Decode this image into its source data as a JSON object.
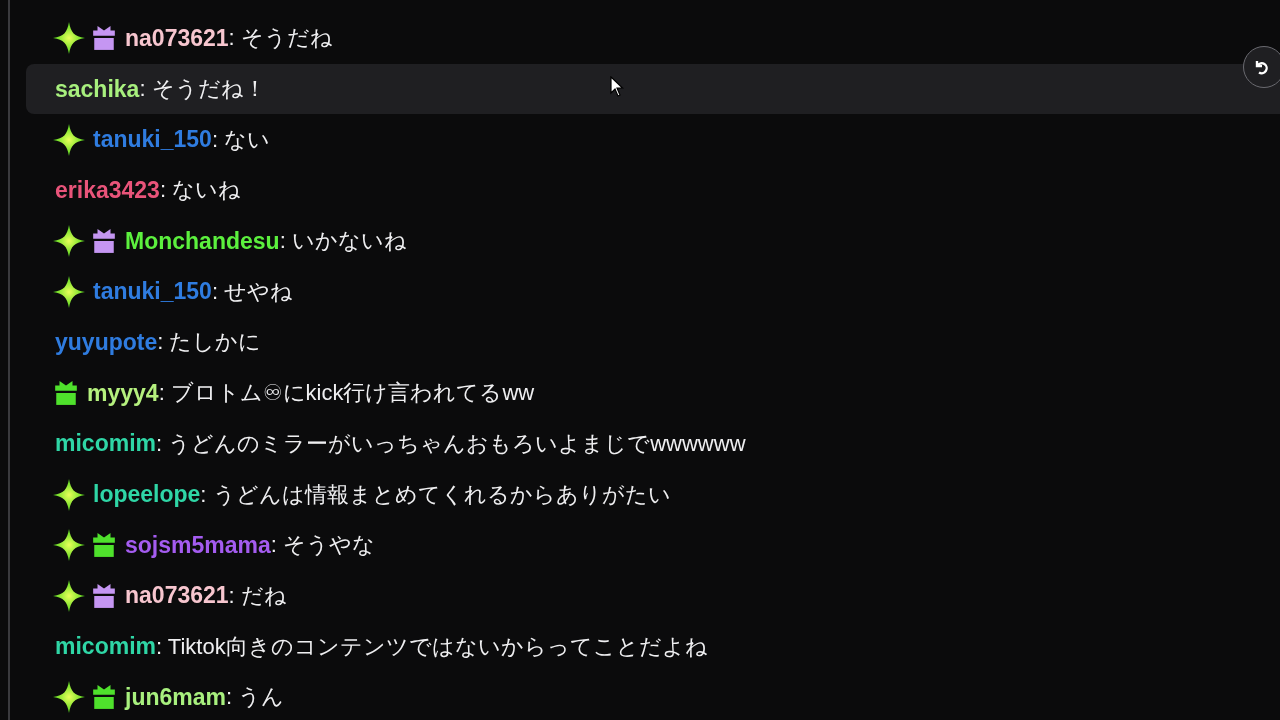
{
  "messages": [
    {
      "badges": [
        {
          "kind": "sparkle"
        },
        {
          "kind": "gift",
          "color": "#c596f2"
        }
      ],
      "username": "na073621",
      "color": "#f7c6cf",
      "text": ": そうだね",
      "highlighted": false
    },
    {
      "username": "sachika",
      "color": "#a8f07e",
      "text": ": そうだね！",
      "highlighted": true
    },
    {
      "badges": [
        {
          "kind": "sparkle"
        }
      ],
      "username": "tanuki_150",
      "color": "#2f7ce0",
      "text": ": ない",
      "highlighted": false
    },
    {
      "username": "erika3423",
      "color": "#e9547a",
      "text": ": ないね",
      "highlighted": false
    },
    {
      "badges": [
        {
          "kind": "sparkle"
        },
        {
          "kind": "gift",
          "color": "#c596f2"
        }
      ],
      "username": "Monchandesu",
      "color": "#5cf03e",
      "text": ": いかないね",
      "highlighted": false
    },
    {
      "badges": [
        {
          "kind": "sparkle"
        }
      ],
      "username": "tanuki_150",
      "color": "#2f7ce0",
      "text": ": せやね",
      "highlighted": false
    },
    {
      "username": "yuyupote",
      "color": "#2f7ce0",
      "text": ": たしかに",
      "highlighted": false
    },
    {
      "badges": [
        {
          "kind": "gift",
          "color": "#4fe12c"
        }
      ],
      "username": "myyy4",
      "color": "#b5f07e",
      "text": ": ブロトム♾にkick行け言われてるww",
      "highlighted": false
    },
    {
      "username": "micomim",
      "color": "#2fd6a6",
      "text": ": うどんのミラーがいっちゃんおもろいよまじでwwwwww",
      "highlighted": false
    },
    {
      "badges": [
        {
          "kind": "sparkle"
        }
      ],
      "username": "lopeelope",
      "color": "#2fd6a6",
      "text": ": うどんは情報まとめてくれるからありがたい",
      "highlighted": false
    },
    {
      "badges": [
        {
          "kind": "sparkle"
        },
        {
          "kind": "gift",
          "color": "#4fe12c"
        }
      ],
      "username": "sojsm5mama",
      "color": "#a45cf0",
      "text": ": そうやな",
      "highlighted": false
    },
    {
      "badges": [
        {
          "kind": "sparkle"
        },
        {
          "kind": "gift",
          "color": "#c596f2"
        }
      ],
      "username": "na073621",
      "color": "#f7c6cf",
      "text": ": だね",
      "highlighted": false
    },
    {
      "username": "micomim",
      "color": "#2fd6a6",
      "text": ": Tiktok向きのコンテンツではないからってことだよね",
      "highlighted": false
    },
    {
      "badges": [
        {
          "kind": "sparkle"
        },
        {
          "kind": "gift",
          "color": "#4fe12c"
        }
      ],
      "username": "jun6mam",
      "color": "#a8f07e",
      "text": ": うん",
      "highlighted": false
    }
  ]
}
